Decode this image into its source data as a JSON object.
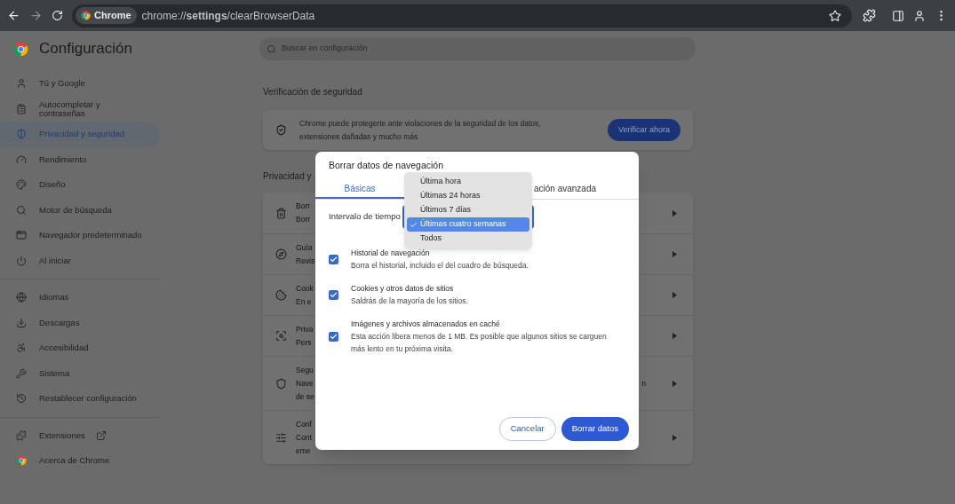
{
  "toolbar": {
    "site_chip": "Chrome",
    "url": "chrome://**settings**/clearBrowserData"
  },
  "header": {
    "title": "Configuración",
    "search_placeholder": "Buscar en configuración"
  },
  "sidebar": {
    "groups": [
      [
        {
          "label": "Tú y Google",
          "selected": false
        },
        {
          "label": "Autocompletar y contraseñas",
          "selected": false
        },
        {
          "label": "Privacidad y seguridad",
          "selected": true
        },
        {
          "label": "Rendimiento",
          "selected": false
        },
        {
          "label": "Diseño",
          "selected": false
        },
        {
          "label": "Motor de búsqueda",
          "selected": false
        },
        {
          "label": "Navegador predeterminado",
          "selected": false
        },
        {
          "label": "Al iniciar",
          "selected": false
        }
      ],
      [
        {
          "label": "Idiomas",
          "selected": false
        },
        {
          "label": "Descargas",
          "selected": false
        },
        {
          "label": "Accesibilidad",
          "selected": false
        },
        {
          "label": "Sistema",
          "selected": false
        },
        {
          "label": "Restablecer configuración",
          "selected": false
        }
      ],
      [
        {
          "label": "Extensiones",
          "selected": false,
          "external": true
        },
        {
          "label": "Acerca de Chrome",
          "selected": false,
          "external": false
        }
      ]
    ]
  },
  "security_check": {
    "heading": "Verificación de seguridad",
    "text": "Chrome puede protegerte ante violaciones de la seguridad de los datos, extensiones dañadas y mucho más",
    "button": "Verificar ahora"
  },
  "privacy": {
    "heading": "Privacidad y",
    "rows": [
      {
        "lines": [
          "Borr",
          "Borr"
        ]
      },
      {
        "lines": [
          "Guía",
          "Revis"
        ]
      },
      {
        "lines": [
          "Cook",
          "En e"
        ]
      },
      {
        "lines": [
          "Priva",
          "Pers"
        ]
      },
      {
        "lines": [
          "Segu",
          "Nave",
          "de se"
        ],
        "right_fragment": "n"
      },
      {
        "lines": [
          "Conf",
          "Cont",
          "eme"
        ]
      }
    ]
  },
  "dialog": {
    "title": "Borrar datos de navegación",
    "tabs": [
      {
        "label": "Básicas",
        "selected": true
      },
      {
        "label": "ación avanzada",
        "selected": false
      }
    ],
    "time_range_label": "Intervalo de tiempo",
    "options": [
      {
        "label": "Última hora",
        "selected": false
      },
      {
        "label": "Últimas 24 horas",
        "selected": false
      },
      {
        "label": "Últimos 7 días",
        "selected": false
      },
      {
        "label": "Últimas cuatro semanas",
        "selected": true
      },
      {
        "label": "Todos",
        "selected": false
      }
    ],
    "items": [
      {
        "title": "Historial de navegación",
        "description": "Borra el historial, incluido el del cuadro de búsqueda.",
        "checked": true
      },
      {
        "title": "Cookies y otros datos de sitios",
        "description": "Saldrás de la mayoría de los sitios.",
        "checked": true
      },
      {
        "title": "Imágenes y archivos almacenados en caché",
        "description": "Esta acción libera menos de 1 MB. Es posible que algunos sitios se carguen más lento en tu próxima visita.",
        "checked": true
      }
    ],
    "cancel": "Cancelar",
    "confirm": "Borrar datos"
  }
}
